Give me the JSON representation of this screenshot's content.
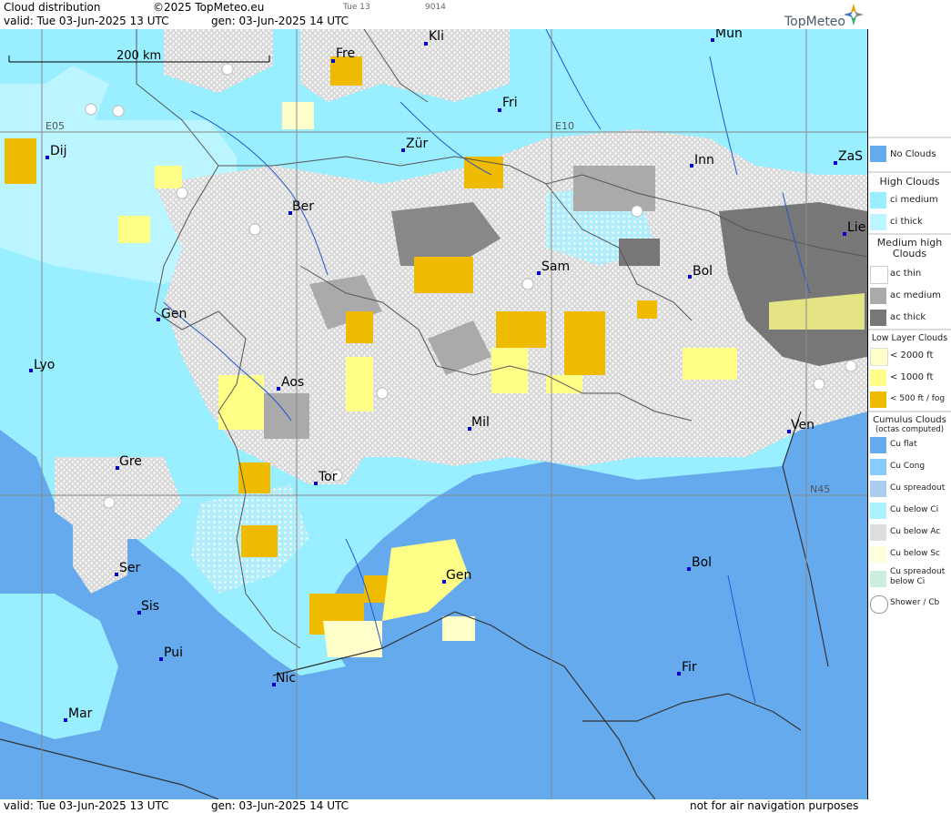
{
  "header": {
    "title": "Cloud distribution",
    "copyright": "©2025 TopMeteo.eu",
    "valid": "valid:  Tue  03-Jun-2025  13 UTC",
    "gen": "gen: 03-Jun-2025 14 UTC",
    "small_day": "Tue 13",
    "small_code": "9014",
    "logo": "TopMeteo"
  },
  "map": {
    "scale_label": "200 km",
    "grid_labels": [
      "E05",
      "E10",
      "N45"
    ],
    "cities": [
      {
        "name": "Fre"
      },
      {
        "name": "Kli"
      },
      {
        "name": "Mun"
      },
      {
        "name": "Fri"
      },
      {
        "name": "Dij"
      },
      {
        "name": "Zür"
      },
      {
        "name": "Inn"
      },
      {
        "name": "ZaS"
      },
      {
        "name": "Ber"
      },
      {
        "name": "Lie"
      },
      {
        "name": "Sam"
      },
      {
        "name": "Bol"
      },
      {
        "name": "Gen"
      },
      {
        "name": "Lyo"
      },
      {
        "name": "Aos"
      },
      {
        "name": "Mil"
      },
      {
        "name": "Ven"
      },
      {
        "name": "Gre"
      },
      {
        "name": "Tor"
      },
      {
        "name": "Gen"
      },
      {
        "name": "Ser"
      },
      {
        "name": "Bol"
      },
      {
        "name": "Sis"
      },
      {
        "name": "Pui"
      },
      {
        "name": "Nic"
      },
      {
        "name": "Fir"
      },
      {
        "name": "Mar"
      }
    ]
  },
  "legend": {
    "no_clouds": "No Clouds",
    "high_clouds": "High Clouds",
    "ci_medium": "ci medium",
    "ci_thick": "ci thick",
    "medium_high": "Medium high Clouds",
    "ac_thin": "ac thin",
    "ac_medium": "ac medium",
    "ac_thick": "ac thick",
    "low_layer": "Low Layer Clouds",
    "low_2000": "< 2000 ft",
    "low_1000": "< 1000 ft",
    "low_500": "< 500 ft / fog",
    "cumulus": "Cumulus Clouds",
    "cumulus_sub": "(octas computed)",
    "cu_flat": "Cu flat",
    "cu_cong": "Cu Cong",
    "cu_spreadout": "Cu spreadout",
    "cu_below_ci": "Cu below Ci",
    "cu_below_ac": "Cu below Ac",
    "cu_below_sc": "Cu below Sc",
    "cu_spread_below_ci": "Cu spreadout below Ci",
    "shower": "Shower / Cb",
    "colors": {
      "no_clouds": "#66aaee",
      "ci_medium": "#99eeff",
      "ci_thick": "#bbf5ff",
      "ac_thin": "#ffffff",
      "ac_medium": "#aaaaaa",
      "ac_thick": "#777777",
      "low_2000": "#ffffcc",
      "low_1000": "#ffff88",
      "low_500": "#eebb00"
    }
  },
  "footer": {
    "valid": "valid:  Tue  03-Jun-2025  13 UTC",
    "gen": "gen: 03-Jun-2025 14 UTC",
    "disclaimer": "not for air navigation purposes"
  }
}
